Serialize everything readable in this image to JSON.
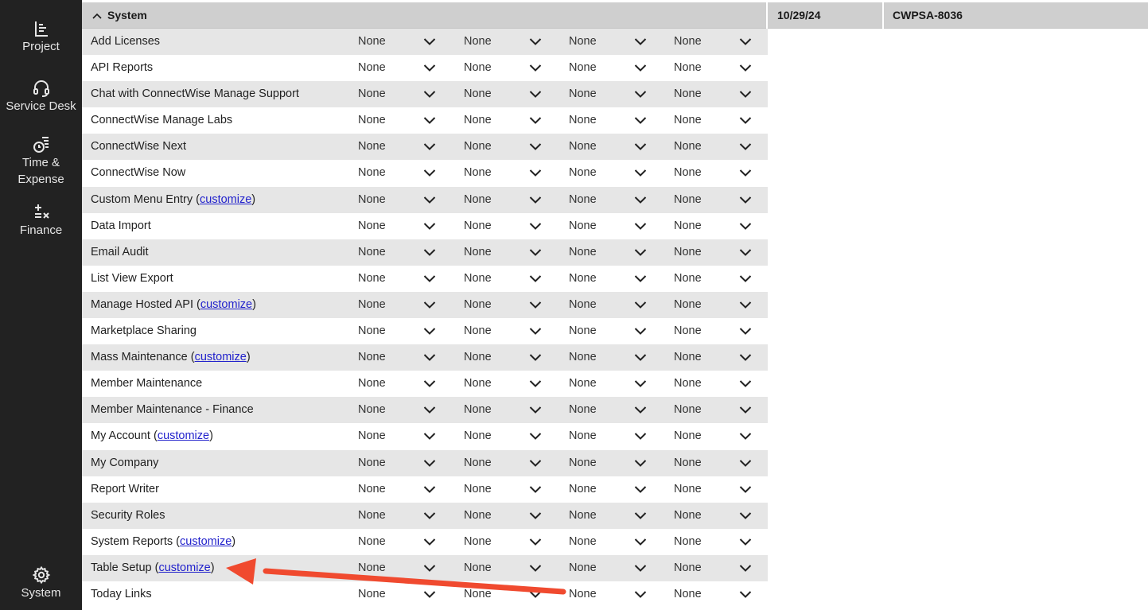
{
  "sidebar": {
    "items": [
      {
        "label": "Project",
        "icon": "project-icon"
      },
      {
        "label": "Service Desk",
        "icon": "headset-icon"
      },
      {
        "label": "Time &\nExpense",
        "label_line1": "Time &",
        "label_line2": "Expense",
        "icon": "stopwatch-list-icon"
      },
      {
        "label": "Finance",
        "icon": "plus-minus-times-icon"
      },
      {
        "label": "System",
        "icon": "gear-icon"
      }
    ]
  },
  "section": {
    "title": "System",
    "date": "10/29/24",
    "ticket": "CWPSA-8036"
  },
  "select_default": "None",
  "link_text": "customize",
  "rows": [
    {
      "name": "Add Licenses",
      "customize": false
    },
    {
      "name": "API Reports",
      "customize": false
    },
    {
      "name": "Chat with ConnectWise Manage Support",
      "customize": false
    },
    {
      "name": "ConnectWise Manage Labs",
      "customize": false
    },
    {
      "name": "ConnectWise Next",
      "customize": false
    },
    {
      "name": "ConnectWise Now",
      "customize": false
    },
    {
      "name": "Custom Menu Entry",
      "customize": true
    },
    {
      "name": "Data Import",
      "customize": false
    },
    {
      "name": "Email Audit",
      "customize": false
    },
    {
      "name": "List View Export",
      "customize": false
    },
    {
      "name": "Manage Hosted API",
      "customize": true
    },
    {
      "name": "Marketplace Sharing",
      "customize": false
    },
    {
      "name": "Mass Maintenance",
      "customize": true
    },
    {
      "name": "Member Maintenance",
      "customize": false
    },
    {
      "name": "Member Maintenance - Finance",
      "customize": false
    },
    {
      "name": "My Account",
      "customize": true
    },
    {
      "name": "My Company",
      "customize": false
    },
    {
      "name": "Report Writer",
      "customize": false
    },
    {
      "name": "Security Roles",
      "customize": false
    },
    {
      "name": "System Reports",
      "customize": true
    },
    {
      "name": "Table Setup",
      "customize": true
    },
    {
      "name": "Today Links",
      "customize": false
    }
  ],
  "annotation": {
    "color": "#f04a2f"
  }
}
